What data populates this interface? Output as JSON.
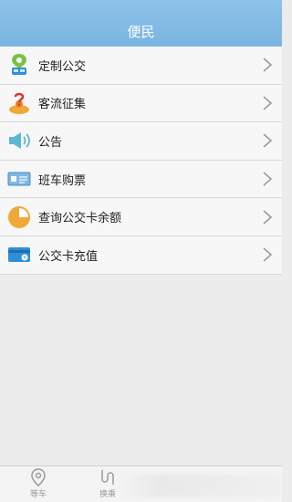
{
  "header": {
    "title": "便民"
  },
  "menu": {
    "items": [
      {
        "label": "定制公交",
        "icon": "bus-stop-icon"
      },
      {
        "label": "客流征集",
        "icon": "question-person-icon"
      },
      {
        "label": "公告",
        "icon": "speaker-icon"
      },
      {
        "label": "班车购票",
        "icon": "ticket-icon"
      },
      {
        "label": "查询公交卡余额",
        "icon": "pie-chart-icon"
      },
      {
        "label": "公交卡充值",
        "icon": "card-recharge-icon"
      }
    ]
  },
  "tabbar": {
    "tabs": [
      {
        "label": "等车",
        "icon": "location-pin-icon"
      },
      {
        "label": "换乘",
        "icon": "route-icon"
      }
    ]
  },
  "colors": {
    "header": "#7fb8e3",
    "accent_orange": "#f0a838"
  }
}
